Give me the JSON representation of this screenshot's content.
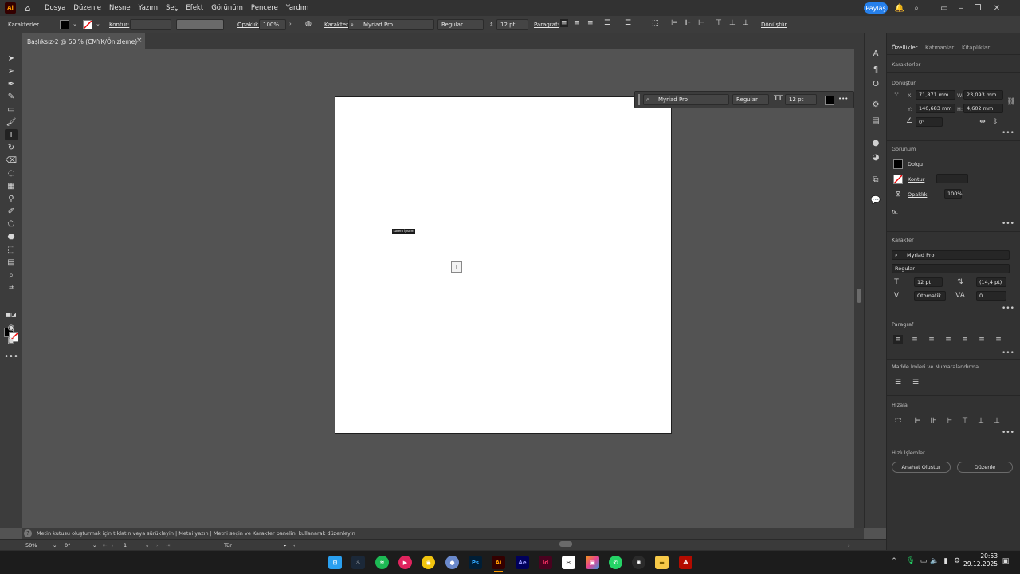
{
  "app": {
    "logo": "Ai",
    "home_icon": "home-icon"
  },
  "menu": [
    "Dosya",
    "Düzenle",
    "Nesne",
    "Yazım",
    "Seç",
    "Efekt",
    "Görünüm",
    "Pencere",
    "Yardım"
  ],
  "topright": {
    "share": "Paylaş",
    "icons": [
      "bell-icon",
      "search-icon",
      "workspace-icon",
      "minimize-icon",
      "restore-icon",
      "close-icon"
    ]
  },
  "controlbar": {
    "panel_label": "Karakterler",
    "stroke_label": "Kontur:",
    "opacity_label": "Opaklık:",
    "opacity_value": "100%",
    "character_label": "Karakter:",
    "font": "Myriad Pro",
    "style": "Regular",
    "size": "12 pt",
    "paragraph_label": "Paragraf:",
    "transform_label": "Dönüştür"
  },
  "document": {
    "tab_title": "Başlıksız-2 @ 50 % (CMYK/Önizleme)",
    "close": "×"
  },
  "canvas": {
    "text_object": "Lorem ipsum"
  },
  "context_bar": {
    "font": "Myriad Pro",
    "style": "Regular",
    "size": "12 pt",
    "more": "•••"
  },
  "panel": {
    "tabs": [
      "Özellikler",
      "Katmanlar",
      "Kitaplıklar"
    ],
    "section_type": "Karakterler",
    "transform": {
      "title": "Dönüştür",
      "x_label": "X:",
      "x": "71,871 mm",
      "y_label": "Y:",
      "y": "140,683 mm",
      "w_label": "W:",
      "w": "23,093 mm",
      "h_label": "H:",
      "h": "4,602 mm",
      "angle": "0°"
    },
    "appearance": {
      "title": "Görünüm",
      "fill": "Dolgu",
      "stroke": "Kontur",
      "opacity_label": "Opaklık",
      "opacity": "100%",
      "fx": "fx."
    },
    "character": {
      "title": "Karakter",
      "font": "Myriad Pro",
      "style": "Regular",
      "size": "12 pt",
      "leading": "(14,4 pt)",
      "kerning": "Otomatik",
      "tracking": "0"
    },
    "paragraph": {
      "title": "Paragraf"
    },
    "bullets": {
      "title": "Madde İmleri ve Numaralandırma"
    },
    "align": {
      "title": "Hizala"
    },
    "quick_actions": {
      "title": "Hızlı İşlemler",
      "create_outlines": "Anahat Oluştur",
      "edit": "Düzenle"
    }
  },
  "status": {
    "hint": "Metin kutusu oluşturmak için tıklatın veya sürükleyin  |  Metni yazın  |  Metni seçin ve Karakter panelini kullanarak düzenleyin",
    "zoom": "50%",
    "rotation": "0°",
    "artboard": "1",
    "tool": "Tür"
  },
  "taskbar": {
    "apps": [
      "windows-start",
      "steam",
      "spotify",
      "music",
      "chrome",
      "app",
      "Ps",
      "Ai",
      "Ae",
      "Id",
      "capcut",
      "gallery",
      "whatsapp",
      "chatgpt",
      "explorer",
      "acrobat"
    ],
    "time": "20:53",
    "date": "29.12.2025"
  }
}
